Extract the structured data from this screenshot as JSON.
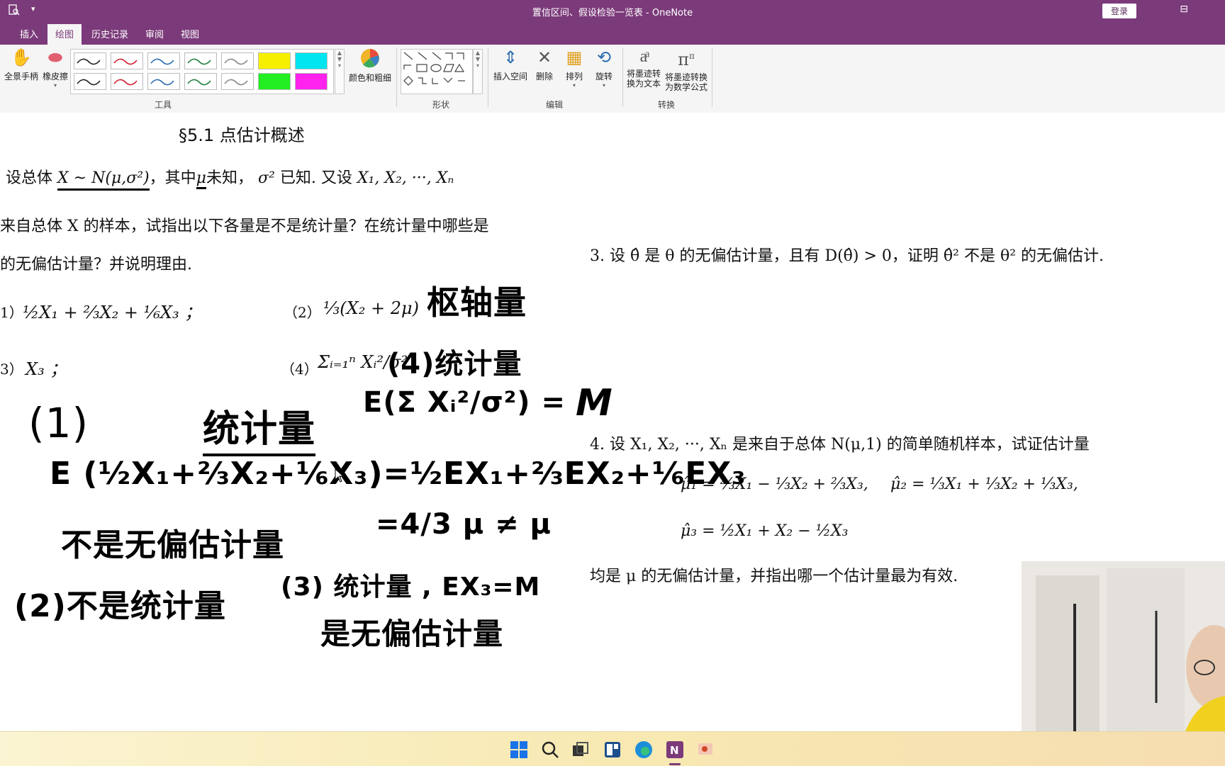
{
  "window": {
    "title": "置信区间、假设检验一览表 - OneNote",
    "login_label": "登录"
  },
  "tabs": [
    {
      "label": "插入"
    },
    {
      "label": "绘图",
      "active": true
    },
    {
      "label": "历史记录"
    },
    {
      "label": "审阅"
    },
    {
      "label": "视图"
    }
  ],
  "ribbon": {
    "tools": {
      "pan_label": "全景手柄",
      "eraser_label": "橡皮擦",
      "color_label": "颜色和粗细",
      "group_label": "工具"
    },
    "pens": [
      {
        "color": "#222222",
        "type": "pen"
      },
      {
        "color": "#d02030",
        "type": "pen"
      },
      {
        "color": "#2a6bb0",
        "type": "pen"
      },
      {
        "color": "#208040",
        "type": "pen"
      },
      {
        "color": "#888888",
        "type": "pen"
      },
      {
        "color": "#f6f000",
        "type": "highlighter"
      },
      {
        "color": "#00e5ef",
        "type": "highlighter"
      },
      {
        "color": "#222222",
        "type": "pen"
      },
      {
        "color": "#d02030",
        "type": "pen"
      },
      {
        "color": "#2a6bb0",
        "type": "pen"
      },
      {
        "color": "#208040",
        "type": "pen"
      },
      {
        "color": "#888888",
        "type": "pen"
      },
      {
        "color": "#22ee22",
        "type": "highlighter"
      },
      {
        "color": "#ff22ee",
        "type": "highlighter"
      }
    ],
    "shapes_group_label": "形状",
    "edit": {
      "insert_space_label": "插入空间",
      "delete_label": "删除",
      "arrange_label": "排列",
      "rotate_label": "旋转",
      "group_label": "编辑"
    },
    "convert": {
      "ink_to_text_line1": "将墨迹转",
      "ink_to_text_line2": "换为文本",
      "ink_to_math_line1": "将墨迹转换",
      "ink_to_math_line2": "为数学公式",
      "group_label": "转换"
    }
  },
  "page": {
    "heading": "§5.1   点估计概述",
    "problem2": {
      "line1_a": "设总体",
      "line1_dist": "X ~ N(μ,σ²)",
      "line1_b": "，其中",
      "line1_mu": "μ",
      "line1_c": "未知，",
      "line1_sigma": "σ²",
      "line1_d": "已知.  又设",
      "line1_sample": "X₁, X₂, ···, Xₙ",
      "line2": "来自总体 X 的样本，试指出以下各量是不是统计量？在统计量中哪些是",
      "line3": "的无偏估计量？并说明理由.",
      "item1_label": "1）",
      "item1_formula": "½X₁ + ⅔X₂ + ⅙X₃  ；",
      "item2_label": "（2）",
      "item2_formula": "⅓(X₂ + 2μ)",
      "item3_label": "3）",
      "item3_formula": "X₃  ；",
      "item4_label": "（4）",
      "item4_formula": "Σᵢ₌₁ⁿ Xᵢ²/σ²"
    },
    "problem3": {
      "text": "3.  设 θ̂ 是 θ 的无偏估计量，且有 D(θ̂) > 0，证明 θ̂² 不是 θ² 的无偏估计."
    },
    "problem4": {
      "line1": "4.  设 X₁, X₂, ···, Xₙ 是来自于总体 N(μ,1) 的简单随机样本，试证估计量",
      "mu1": "μ̂₁ = ⅔X₁ − ⅓X₂ + ⅔X₃,",
      "mu2": "μ̂₂ = ⅓X₁ + ⅓X₂ + ⅓X₃,",
      "mu3": "μ̂₃ = ½X₁ + X₂ − ½X₃",
      "line_last": "均是 μ 的无偏估计量，并指出哪一个估计量最为有效."
    },
    "handwriting": {
      "pivot": "枢轴量",
      "item4_stat": "(4)统计量",
      "item4_expect": "E(Σ Xᵢ²/σ²) =",
      "mu_big": "M",
      "one": "(1)",
      "stat": "统计量",
      "expectation": "E (½X₁+⅔X₂+⅙X₃)=½EX₁+⅔EX₂+⅙EX₃",
      "equals": "=4/3 μ ≠ μ",
      "biased": "不是无偏估计量",
      "two": "(2)不是统计量",
      "three": "(3)  统计量 , EX₃=M",
      "unbiased": "是无偏估计量"
    }
  }
}
